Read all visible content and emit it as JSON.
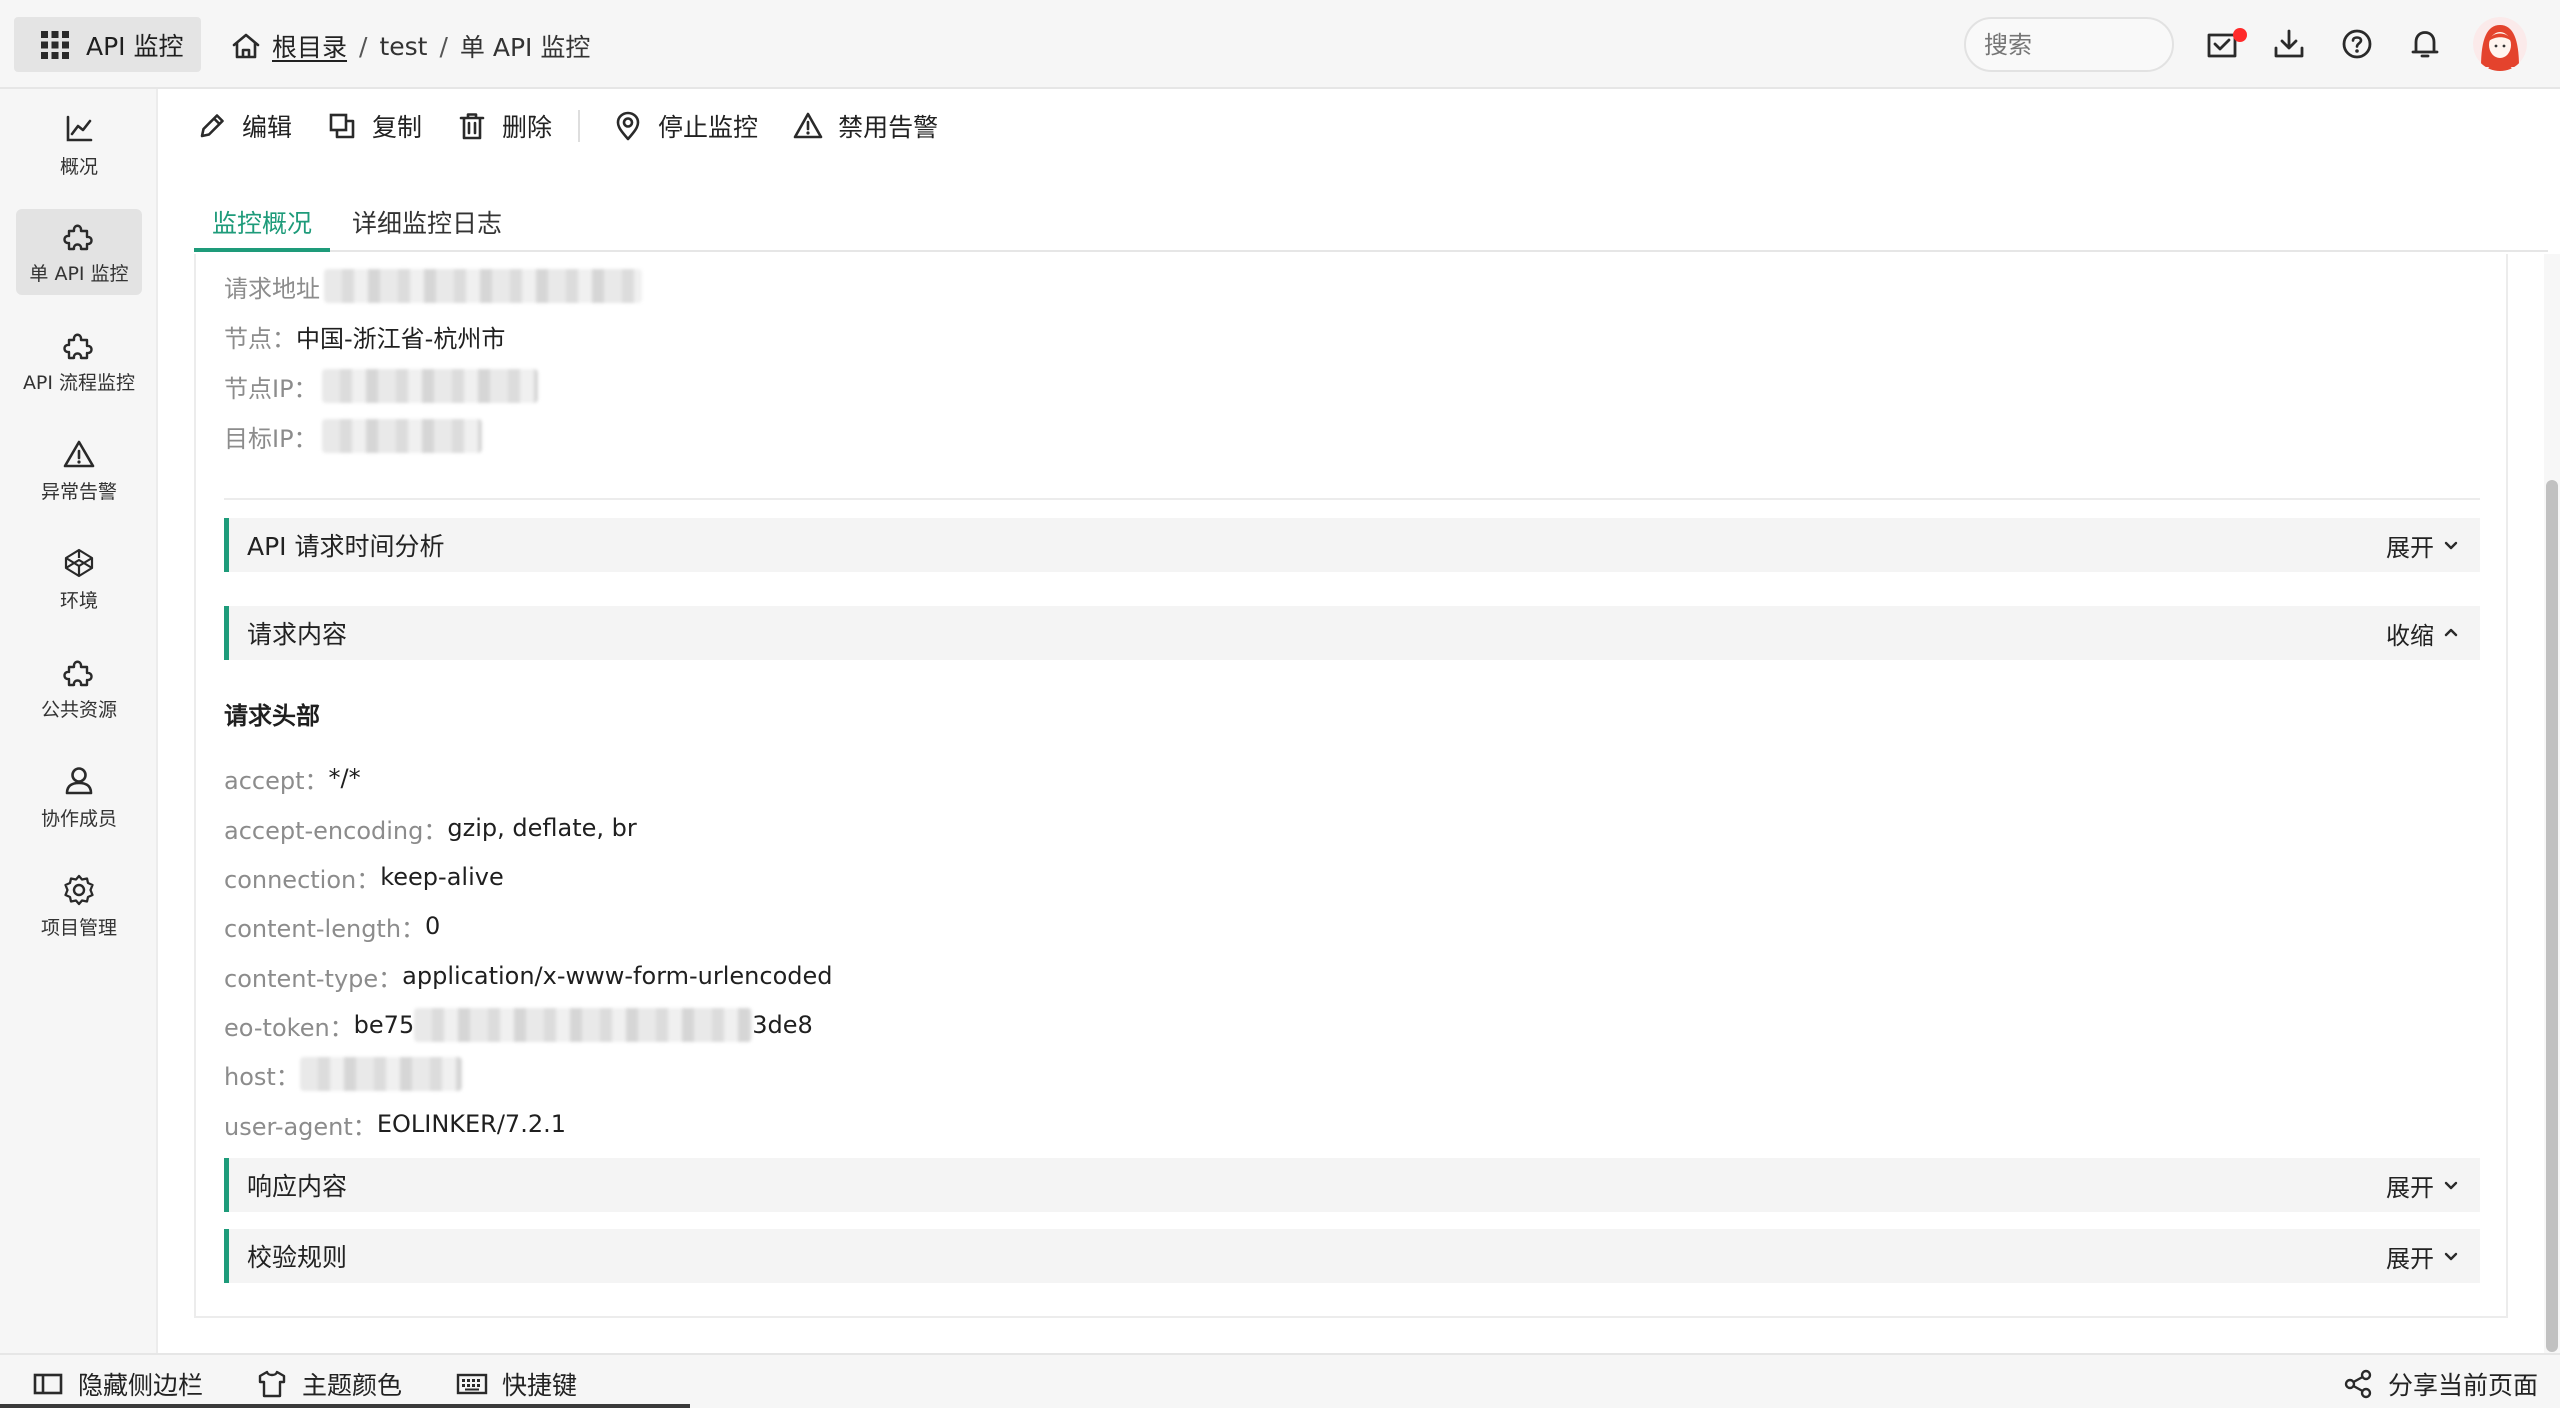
{
  "app": {
    "switch_label": "API 监控"
  },
  "breadcrumb": {
    "root": "根目录",
    "items": [
      "test",
      "单 API 监控"
    ],
    "separator": "/"
  },
  "search": {
    "placeholder": "搜索"
  },
  "sidebar": {
    "items": [
      {
        "label": "概况",
        "icon": "chart-line-icon"
      },
      {
        "label": "单 API 监控",
        "icon": "puzzle-icon",
        "active": true
      },
      {
        "label": "API 流程监控",
        "icon": "puzzle-icon"
      },
      {
        "label": "异常告警",
        "icon": "warning-icon"
      },
      {
        "label": "环境",
        "icon": "codepen-icon"
      },
      {
        "label": "公共资源",
        "icon": "puzzle-icon"
      },
      {
        "label": "协作成员",
        "icon": "user-icon"
      },
      {
        "label": "项目管理",
        "icon": "gear-icon"
      }
    ]
  },
  "toolbar": {
    "edit": "编辑",
    "copy": "复制",
    "delete": "删除",
    "stop_monitor": "停止监控",
    "disable_alert": "禁用告警"
  },
  "tabs": [
    {
      "label": "监控概况",
      "active": true
    },
    {
      "label": "详细监控日志",
      "active": false
    }
  ],
  "info": {
    "request_url_label": "请求地址",
    "node_label": "节点：",
    "node_value": "中国-浙江省-杭州市",
    "node_ip_label": "节点IP：",
    "target_ip_label": "目标IP："
  },
  "sections": {
    "timing": {
      "title": "API 请求时间分析",
      "toggle": "展开"
    },
    "request": {
      "title": "请求内容",
      "toggle": "收缩"
    },
    "response": {
      "title": "响应内容",
      "toggle": "展开"
    },
    "rules": {
      "title": "校验规则",
      "toggle": "展开"
    }
  },
  "request_headers": {
    "title": "请求头部",
    "rows": [
      {
        "key": "accept：",
        "value": "*/*"
      },
      {
        "key": "accept-encoding：",
        "value": "gzip, deflate, br"
      },
      {
        "key": "connection：",
        "value": "keep-alive"
      },
      {
        "key": "content-length：",
        "value": "0"
      },
      {
        "key": "content-type：",
        "value": "application/x-www-form-urlencoded"
      },
      {
        "key": "eo-token：",
        "value_prefix": "be75",
        "value_suffix": "3de8"
      },
      {
        "key": "host：",
        "value": ""
      },
      {
        "key": "user-agent：",
        "value": "EOLINKER/7.2.1"
      }
    ]
  },
  "bottombar": {
    "hide_sidebar": "隐藏侧边栏",
    "theme_color": "主题颜色",
    "shortcuts": "快捷键",
    "share_page": "分享当前页面"
  },
  "colors": {
    "accent": "#1e9b7a",
    "badge": "#ff2a2a"
  }
}
